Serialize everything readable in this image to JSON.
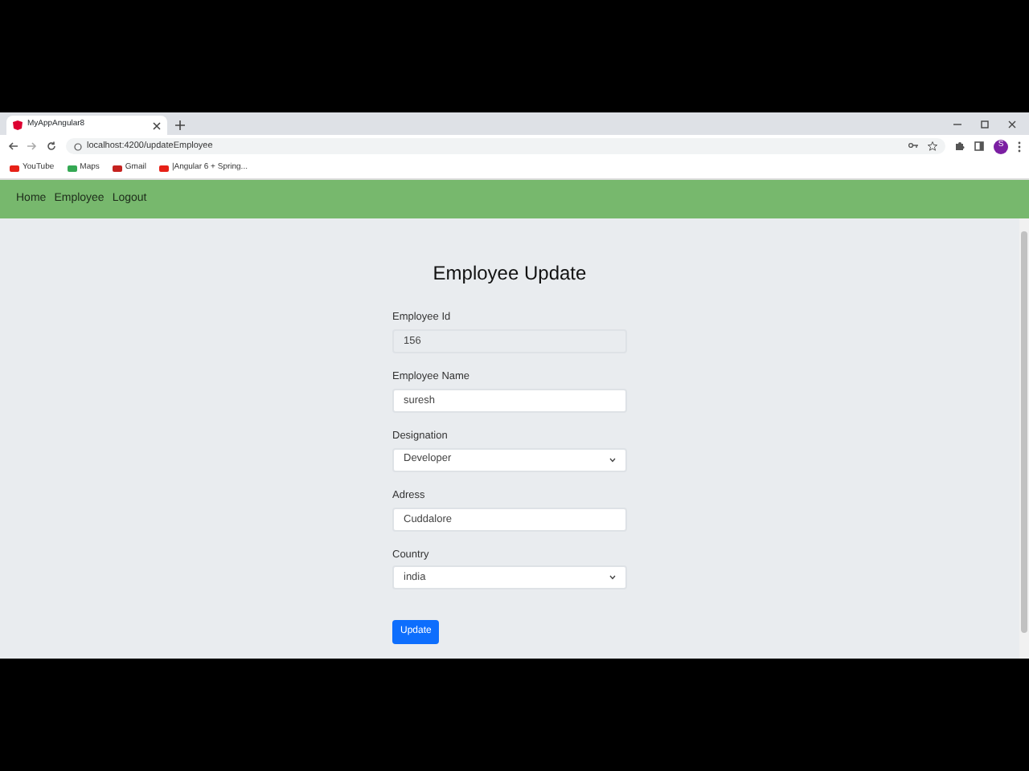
{
  "browser": {
    "tab_title": "MyAppAngular8",
    "url": "localhost:4200/updateEmployee",
    "profile": "S",
    "bookmarks": [
      {
        "label": "YouTube",
        "color": "#e62117"
      },
      {
        "label": "Maps",
        "color": "#34a853"
      },
      {
        "label": "Gmail",
        "color": "#c5221f"
      },
      {
        "label": "|Angular 6 + Spring...",
        "color": "#e62117"
      }
    ]
  },
  "navbar": {
    "links": [
      "Home",
      "Employee",
      "Logout"
    ]
  },
  "form": {
    "title": "Employee Update",
    "fields": [
      {
        "label": "Employee Id",
        "value": "156",
        "kind": "input",
        "disabled": true
      },
      {
        "label": "Employee Name",
        "value": "suresh",
        "kind": "input",
        "disabled": false
      },
      {
        "label": "Designation",
        "value": "Developer",
        "kind": "select",
        "disabled": false
      },
      {
        "label": "Adress",
        "value": "Cuddalore",
        "kind": "input",
        "disabled": false
      },
      {
        "label": "Country",
        "value": "india",
        "kind": "select",
        "disabled": false
      }
    ],
    "button": "Update"
  }
}
